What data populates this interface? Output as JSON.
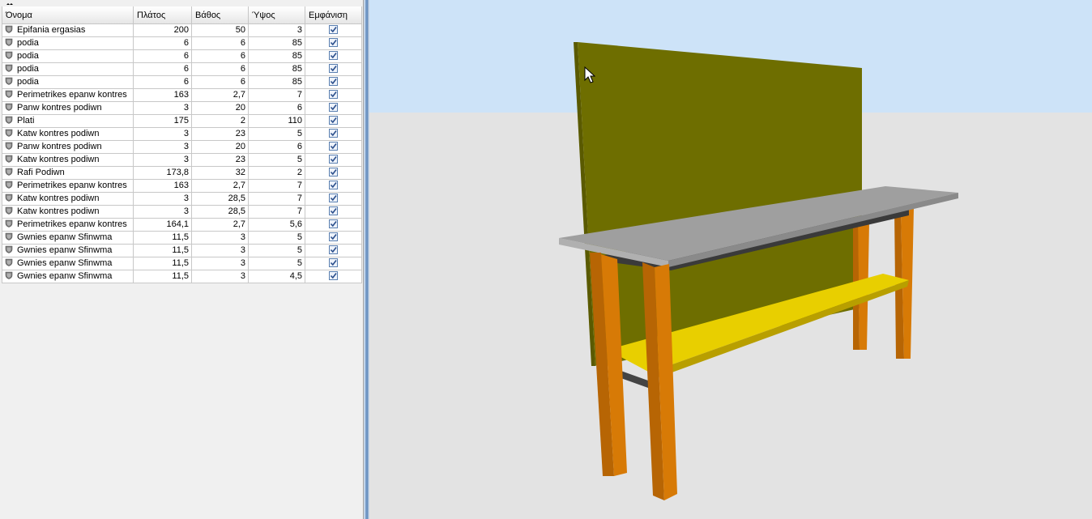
{
  "table": {
    "headers": {
      "name": "Όνομα",
      "width": "Πλάτος",
      "depth": "Βάθος",
      "height": "Ύψος",
      "visible": "Εμφάνιση"
    },
    "rows": [
      {
        "name": "Epifania ergasias",
        "width": "200",
        "depth": "50",
        "height": "3",
        "visible": true
      },
      {
        "name": "podia",
        "width": "6",
        "depth": "6",
        "height": "85",
        "visible": true
      },
      {
        "name": "podia",
        "width": "6",
        "depth": "6",
        "height": "85",
        "visible": true
      },
      {
        "name": "podia",
        "width": "6",
        "depth": "6",
        "height": "85",
        "visible": true
      },
      {
        "name": "podia",
        "width": "6",
        "depth": "6",
        "height": "85",
        "visible": true
      },
      {
        "name": "Perimetrikes epanw kontres",
        "width": "163",
        "depth": "2,7",
        "height": "7",
        "visible": true
      },
      {
        "name": "Panw kontres podiwn",
        "width": "3",
        "depth": "20",
        "height": "6",
        "visible": true
      },
      {
        "name": "Plati",
        "width": "175",
        "depth": "2",
        "height": "110",
        "visible": true
      },
      {
        "name": "Katw kontres podiwn",
        "width": "3",
        "depth": "23",
        "height": "5",
        "visible": true
      },
      {
        "name": "Panw kontres podiwn",
        "width": "3",
        "depth": "20",
        "height": "6",
        "visible": true
      },
      {
        "name": "Katw kontres podiwn",
        "width": "3",
        "depth": "23",
        "height": "5",
        "visible": true
      },
      {
        "name": "Rafi Podiwn",
        "width": "173,8",
        "depth": "32",
        "height": "2",
        "visible": true
      },
      {
        "name": "Perimetrikes epanw kontres",
        "width": "163",
        "depth": "2,7",
        "height": "7",
        "visible": true
      },
      {
        "name": "Katw kontres podiwn",
        "width": "3",
        "depth": "28,5",
        "height": "7",
        "visible": true
      },
      {
        "name": "Katw kontres podiwn",
        "width": "3",
        "depth": "28,5",
        "height": "7",
        "visible": true
      },
      {
        "name": "Perimetrikes epanw kontres",
        "width": "164,1",
        "depth": "2,7",
        "height": "5,6",
        "visible": true
      },
      {
        "name": "Gwnies epanw Sfinwma",
        "width": "11,5",
        "depth": "3",
        "height": "5",
        "visible": true
      },
      {
        "name": "Gwnies epanw Sfinwma",
        "width": "11,5",
        "depth": "3",
        "height": "5",
        "visible": true
      },
      {
        "name": "Gwnies epanw Sfinwma",
        "width": "11,5",
        "depth": "3",
        "height": "5",
        "visible": true
      },
      {
        "name": "Gwnies epanw Sfinwma",
        "width": "11,5",
        "depth": "3",
        "height": "4,5",
        "visible": true
      }
    ]
  },
  "icons": {
    "row_icon": "shield-icon",
    "corner": "resize-handle-icon",
    "cursor": "mouse-cursor-icon"
  },
  "colors": {
    "sky": "#cde3f8",
    "floor": "#e3e3e3",
    "backboard": "#6e6e00",
    "tabletop": "#9f9f9f",
    "legs": "#d77a06",
    "shelf": "#e8cf00",
    "splitter": "#6e95c6"
  }
}
